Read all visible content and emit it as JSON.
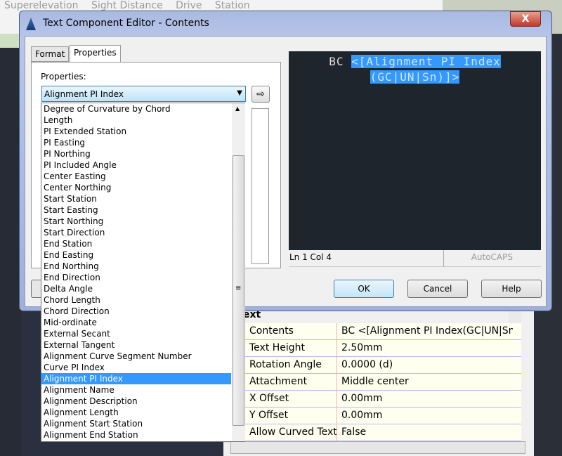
{
  "background": {
    "ribbon_tabs": [
      "Superelevation",
      "Sight Distance",
      "Drive",
      "Station"
    ],
    "grid_header": "ext",
    "grid_rows": [
      {
        "k": "Contents",
        "v": "BC <[Alignment PI Index(GC|UN|Sn)"
      },
      {
        "k": "Text Height",
        "v": "2.50mm"
      },
      {
        "k": "Rotation Angle",
        "v": "0.0000 (d)"
      },
      {
        "k": "Attachment",
        "v": "Middle center"
      },
      {
        "k": "X Offset",
        "v": "0.00mm"
      },
      {
        "k": "Y Offset",
        "v": "0.00mm"
      },
      {
        "k": "Allow Curved Text",
        "v": "False"
      }
    ]
  },
  "dialog": {
    "title": "Text Component Editor - Contents",
    "close": "X",
    "tabs": [
      "Format",
      "Properties"
    ],
    "active_tab": "Properties",
    "properties_label": "Properties:",
    "selected_property": "Alignment PI Index",
    "insert_icon": "arrow-right-icon",
    "preview": {
      "plain": "BC ",
      "selected_line1": "<[Alignment PI Index",
      "selected_line2": "(GC|UN|Sn)]>"
    },
    "status": {
      "position": "Ln 1 Col 4",
      "mode": "AutoCAPS"
    },
    "buttons": {
      "ok": "OK",
      "cancel": "Cancel",
      "help": "Help"
    },
    "dropdown_items": [
      "Degree of Curvature by Chord",
      "Length",
      "PI Extended Station",
      "PI Easting",
      "PI Northing",
      "PI Included Angle",
      "Center Easting",
      "Center Northing",
      "Start Station",
      "Start Easting",
      "Start Northing",
      "Start Direction",
      "End Station",
      "End Easting",
      "End Northing",
      "End Direction",
      "Delta Angle",
      "Chord Length",
      "Chord Direction",
      "Mid-ordinate",
      "External Secant",
      "External Tangent",
      "Alignment Curve Segment Number",
      "Curve PI Index",
      "Alignment PI Index",
      "Alignment Name",
      "Alignment Description",
      "Alignment Length",
      "Alignment Start Station",
      "Alignment End Station"
    ],
    "selected_index": 24
  },
  "colors": {
    "selection": "#3399ff",
    "preview_bg": "#1f252d"
  }
}
